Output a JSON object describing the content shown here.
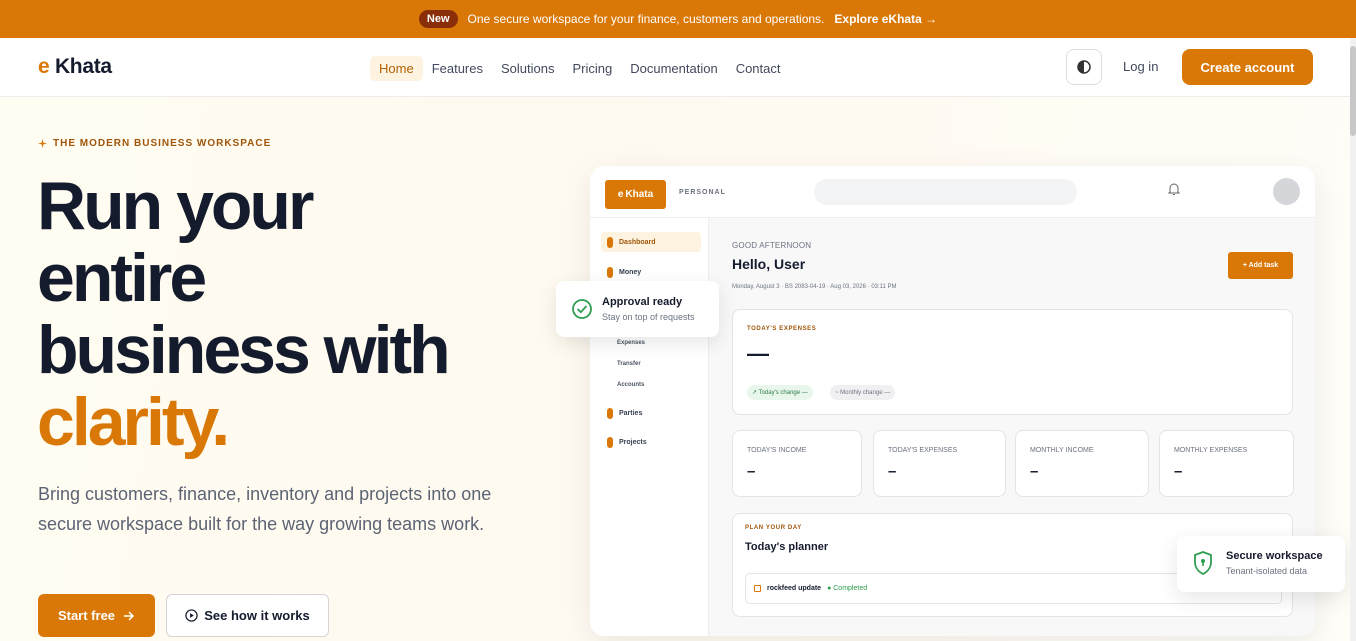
{
  "announcement": {
    "badge": "New",
    "text": "One secure workspace for your finance, customers and operations.",
    "link": "Explore eKhata →"
  },
  "nav": {
    "logo_prefix": "e",
    "logo_text": "Khata",
    "items": [
      "Home",
      "Features",
      "Solutions",
      "Pricing",
      "Documentation",
      "Contact"
    ],
    "active": "Home",
    "login": "Log in",
    "create_account": "Create account"
  },
  "hero": {
    "eyebrow": "THE MODERN BUSINESS WORKSPACE",
    "headline_line1": "Run your",
    "headline_line2": "entire",
    "headline_line3": "business with",
    "headline_accent": "clarity.",
    "subtext": "Bring customers, finance, inventory and projects into one secure workspace built for the way growing teams work.",
    "cta_primary": "Start free",
    "cta_secondary": "See how it works"
  },
  "preview": {
    "logo_prefix": "e",
    "logo_text": "Khata",
    "mode": "PERSONAL",
    "sidebar": {
      "dashboard": "Dashboard",
      "money": "Money",
      "expenses": "Expenses",
      "transfer": "Transfer",
      "accounts": "Accounts",
      "parties": "Parties",
      "projects": "Projects"
    },
    "greeting": "GOOD AFTERNOON",
    "hello": "Hello, User",
    "date_line": "Monday, August 3 · BS 2083-04-19 · Aug 03, 2026 · 03:11 PM",
    "add_task": "+ Add task",
    "todays_expenses": {
      "title": "TODAY'S EXPENSES",
      "value": "—",
      "chip_today": "↗ Today's change —",
      "chip_monthly": "~ Monthly change —"
    },
    "stats": [
      {
        "label": "TODAY'S INCOME",
        "value": "–"
      },
      {
        "label": "TODAY'S EXPENSES",
        "value": "–"
      },
      {
        "label": "MONTHLY INCOME",
        "value": "–"
      },
      {
        "label": "MONTHLY EXPENSES",
        "value": "–"
      }
    ],
    "planner": {
      "eyebrow": "PLAN YOUR DAY",
      "title": "Today's planner",
      "task_name": "rockfeed update",
      "task_status": "● Completed"
    }
  },
  "float_approval": {
    "title": "Approval ready",
    "subtitle": "Stay on top of requests"
  },
  "float_secure": {
    "title": "Secure workspace",
    "subtitle": "Tenant-isolated data"
  },
  "colors": {
    "accent": "#d97806",
    "badge": "#8a2e0a",
    "text_dark": "#141b2d",
    "success": "#2e9d4f"
  }
}
